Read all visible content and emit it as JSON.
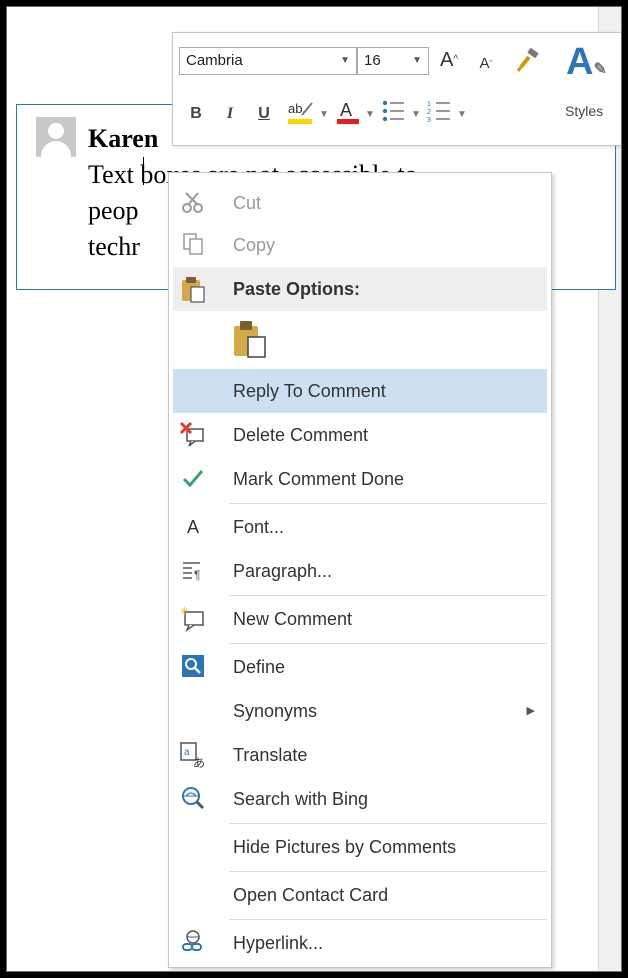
{
  "comment": {
    "author": "Karen",
    "line1": "Text boxes are not accessible to",
    "line2": "peop",
    "line3": "techr"
  },
  "mini_toolbar": {
    "font_name": "Cambria",
    "font_size": "16",
    "styles_label": "Styles"
  },
  "context_menu": {
    "cut": "Cut",
    "copy": "Copy",
    "paste_header": "Paste Options:",
    "reply": "Reply To Comment",
    "delete": "Delete Comment",
    "mark_done": "Mark Comment Done",
    "font": "Font...",
    "paragraph": "Paragraph...",
    "new_comment": "New Comment",
    "define": "Define",
    "synonyms": "Synonyms",
    "translate": "Translate",
    "search_bing": "Search with Bing",
    "hide_pictures": "Hide Pictures by Comments",
    "contact_card": "Open Contact Card",
    "hyperlink": "Hyperlink..."
  },
  "colors": {
    "highlight": "#cce0f2",
    "accent": "#2e75b6",
    "delete_red": "#e03a2e",
    "check_green": "#3aa36f"
  },
  "icons": {
    "cut": "scissors-icon",
    "copy": "copy-icon",
    "paste": "clipboard-icon",
    "delete": "delete-comment-icon",
    "mark_done": "checkmark-icon",
    "font": "font-icon",
    "paragraph": "paragraph-icon",
    "new_comment": "new-comment-icon",
    "define": "define-icon",
    "translate": "translate-icon",
    "search": "search-bing-icon",
    "hyperlink": "hyperlink-icon"
  }
}
